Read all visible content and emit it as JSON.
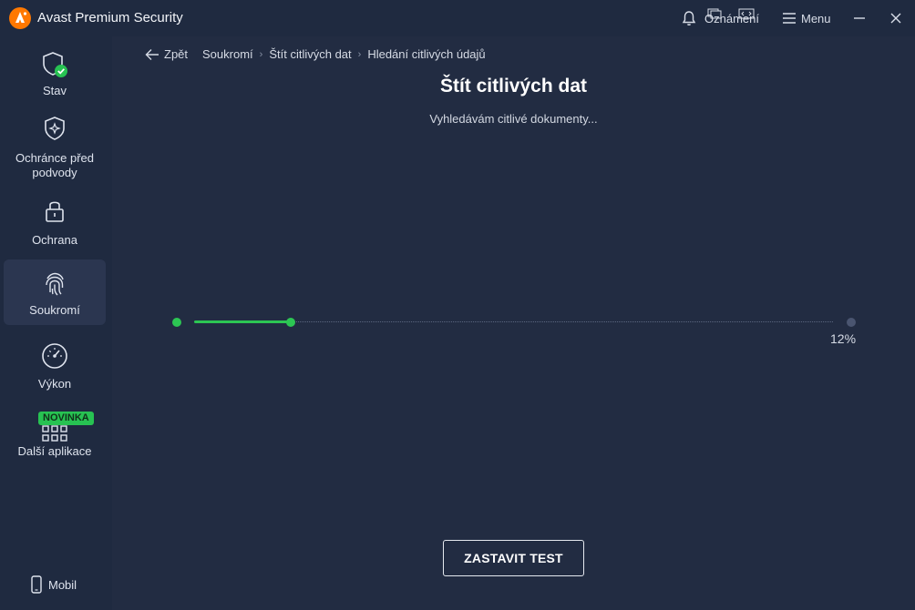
{
  "app": {
    "title": "Avast Premium Security",
    "accent_color": "#ff7800"
  },
  "titlebar": {
    "notifications_label": "Oznámení",
    "menu_label": "Menu",
    "icons": [
      "bell-icon",
      "menu-icon",
      "minimize-icon",
      "close-icon"
    ]
  },
  "sidebar": {
    "items": [
      {
        "label": "Stav",
        "icon": "shield-check-icon"
      },
      {
        "label": "Ochránce před podvody",
        "icon": "shield-sparkle-icon"
      },
      {
        "label": "Ochrana",
        "icon": "lock-icon"
      },
      {
        "label": "Soukromí",
        "icon": "fingerprint-icon",
        "active": true
      },
      {
        "label": "Výkon",
        "icon": "gauge-icon"
      },
      {
        "label": "Další aplikace",
        "icon": "apps-grid-icon",
        "badge": "NOVINKA"
      }
    ],
    "mobile_label": "Mobil"
  },
  "breadcrumb": {
    "back_label": "Zpět",
    "items": [
      "Soukromí",
      "Štít citlivých dat",
      "Hledání citlivých údajů"
    ]
  },
  "main": {
    "title": "Štít citlivých dat",
    "status": "Vyhledávám citlivé dokumenty...",
    "progress_value": 12,
    "progress_label": "12%",
    "stop_button_label": "ZASTAVIT TEST"
  },
  "colors": {
    "background": "#1f2a40",
    "content": "#222c42",
    "progress": "#2cc653",
    "badge": "#27c252"
  }
}
